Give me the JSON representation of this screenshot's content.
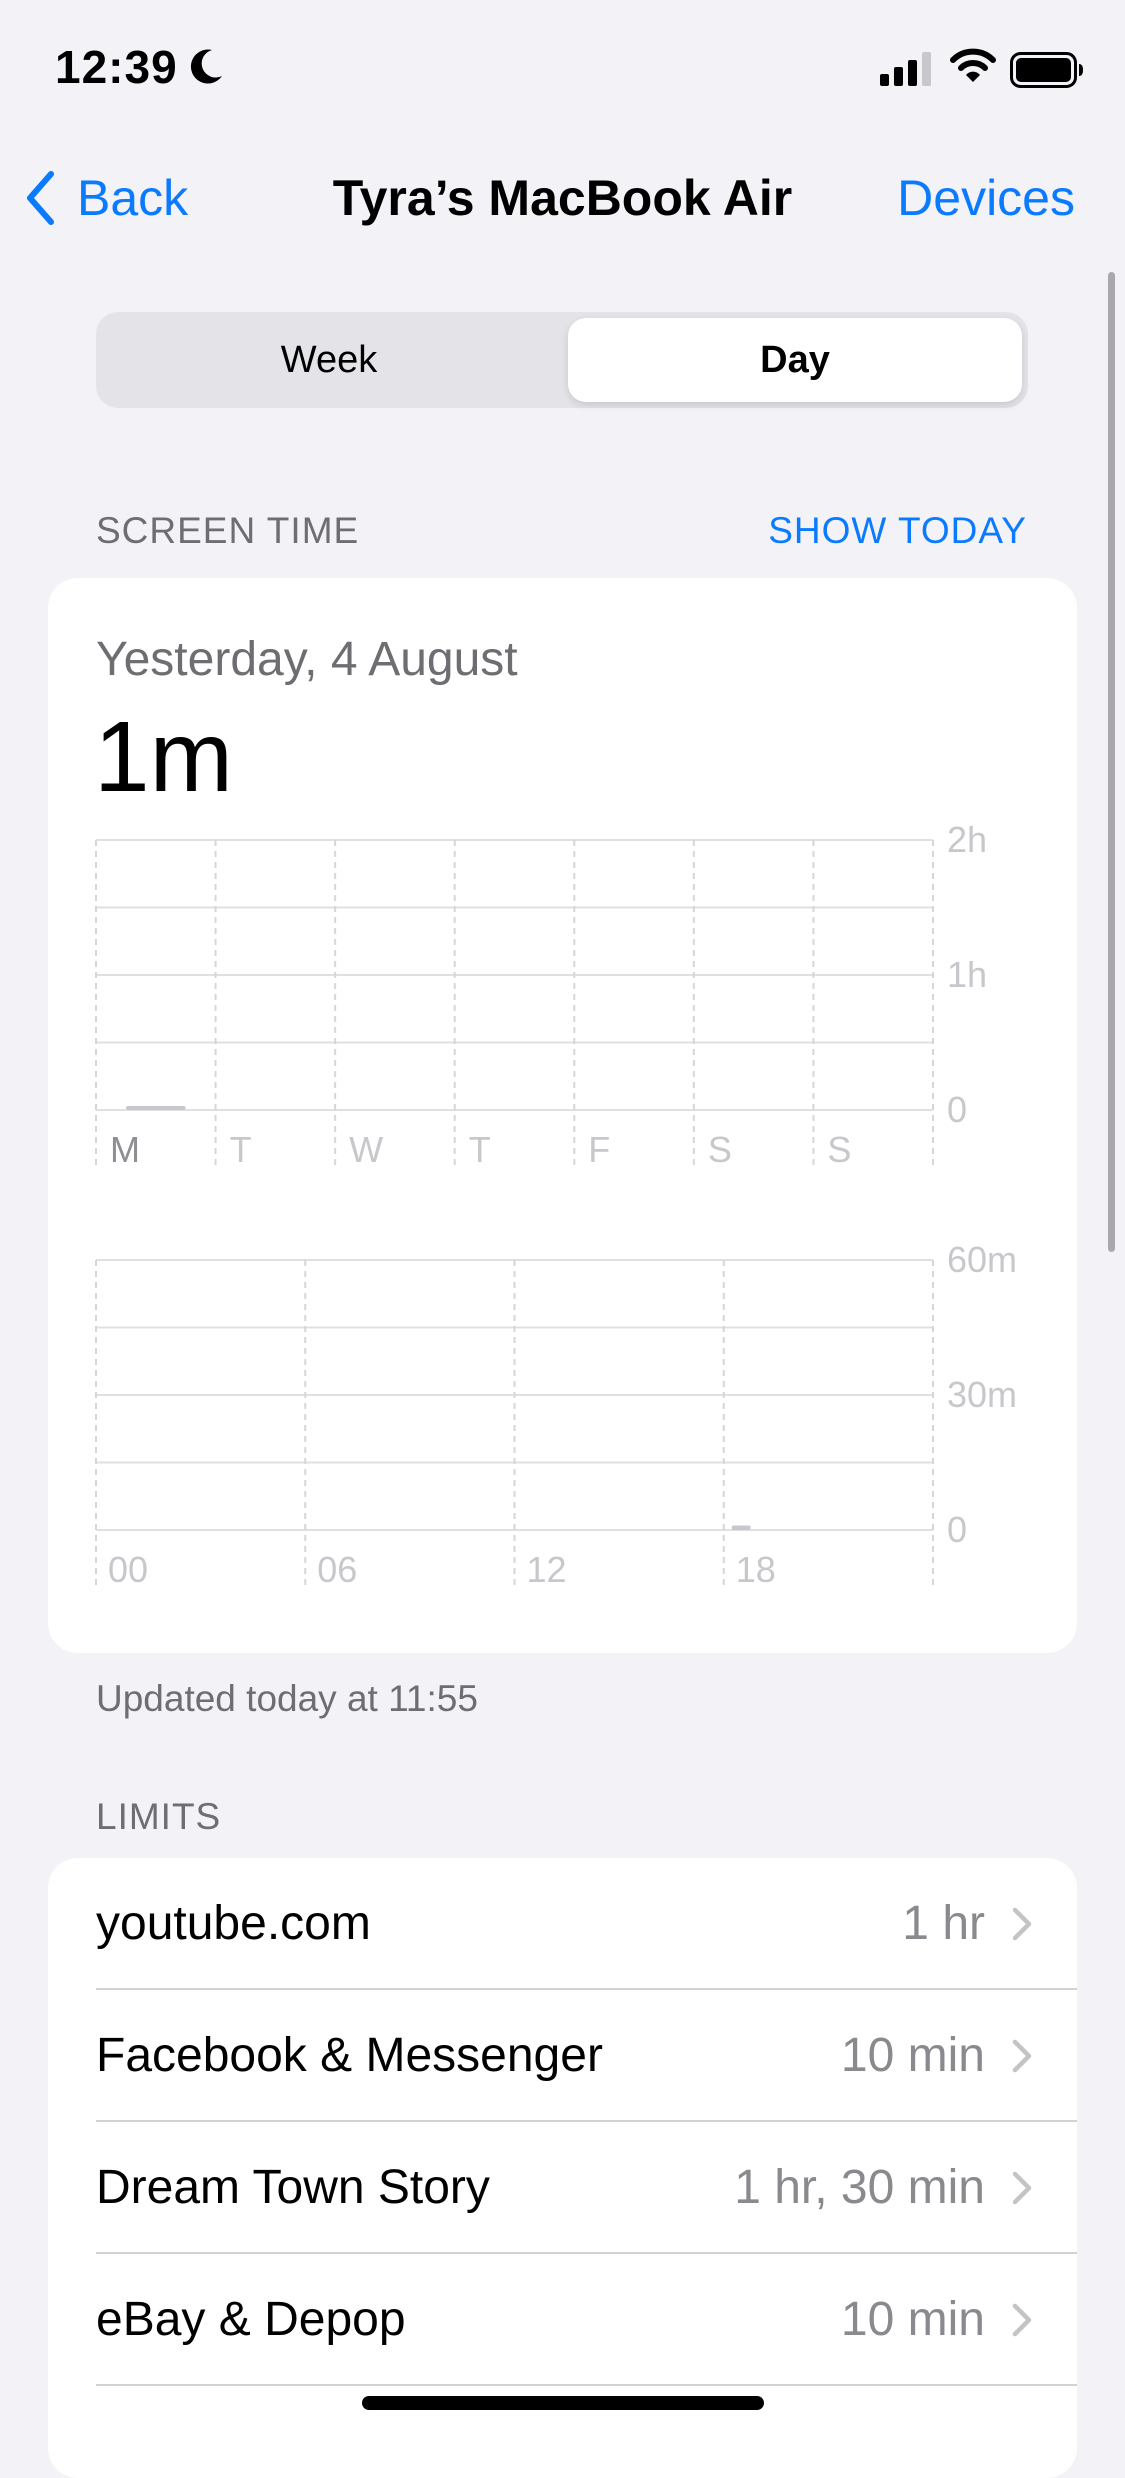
{
  "status_bar": {
    "time": "12:39"
  },
  "nav": {
    "back_label": "Back",
    "title": "Tyra’s MacBook Air",
    "devices_label": "Devices"
  },
  "segment": {
    "week_label": "Week",
    "day_label": "Day",
    "selected": "Day"
  },
  "screen_time": {
    "section_label": "SCREEN TIME",
    "show_today_label": "SHOW TODAY",
    "date": "Yesterday, 4 August",
    "total": "1m",
    "updated": "Updated today at 11:55"
  },
  "chart_data": [
    {
      "type": "bar",
      "categories": [
        "M",
        "T",
        "W",
        "T",
        "F",
        "S",
        "S"
      ],
      "values": [
        1,
        0,
        0,
        0,
        0,
        0,
        0
      ],
      "unit": "minutes",
      "ylim": [
        0,
        120
      ],
      "ytick_labels": [
        "0",
        "1h",
        "2h"
      ],
      "highlighted_category": "M"
    },
    {
      "type": "bar",
      "categories": [
        "00",
        "06",
        "12",
        "18"
      ],
      "x_hours": [
        0,
        6,
        12,
        18
      ],
      "hourly_values": [
        {
          "hour": 18,
          "value": 1
        }
      ],
      "unit": "minutes",
      "ylim": [
        0,
        60
      ],
      "ytick_labels": [
        "0",
        "30m",
        "60m"
      ]
    }
  ],
  "limits": {
    "section_label": "LIMITS",
    "items": [
      {
        "name": "youtube.com",
        "value": "1 hr"
      },
      {
        "name": "Facebook & Messenger",
        "value": "10 min"
      },
      {
        "name": "Dream Town Story",
        "value": "1 hr, 30 min"
      },
      {
        "name": "eBay & Depop",
        "value": "10 min"
      }
    ]
  },
  "colors": {
    "accent": "#0a7aff",
    "background": "#f2f2f7",
    "bar": "#c7c7cc"
  }
}
